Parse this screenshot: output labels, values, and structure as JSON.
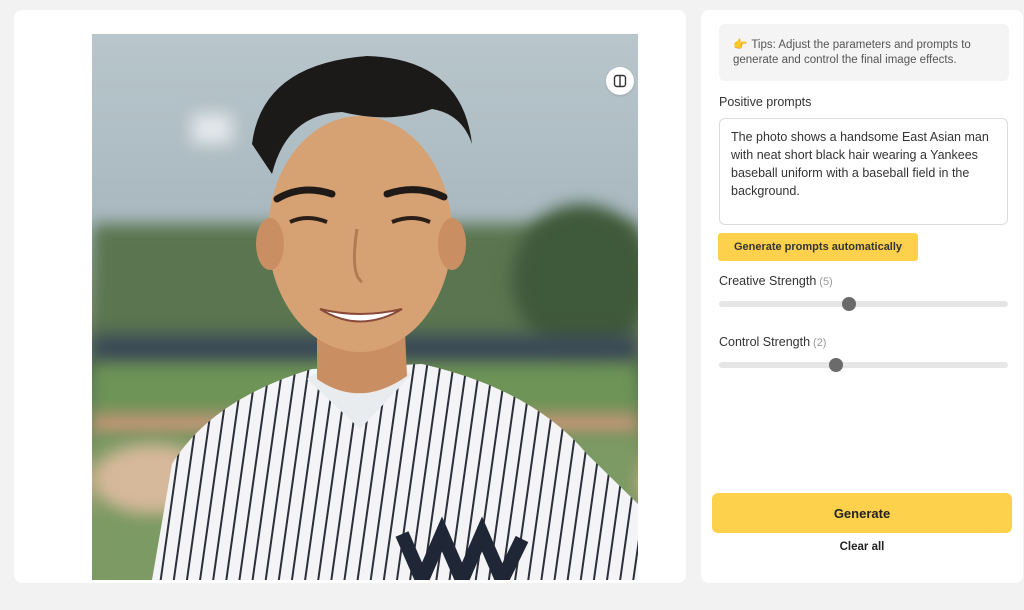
{
  "image_tools": {
    "compare_icon": "split-view-icon",
    "download_icon": "download-icon",
    "delete_icon": "trash-icon"
  },
  "tips": {
    "icon": "pointing-hand-icon",
    "text": "Tips: Adjust the parameters and prompts to generate and control the final image effects."
  },
  "positive_prompts": {
    "label": "Positive prompts",
    "value": "The photo shows a handsome East Asian man with neat short black hair wearing a Yankees baseball uniform with a baseball field in the background."
  },
  "auto_prompt_button": "Generate prompts automatically",
  "creative_strength": {
    "label": "Creative Strength",
    "value_text": "(5)",
    "value": 5,
    "fraction": 0.45
  },
  "control_strength": {
    "label": "Control Strength",
    "value_text": "(2)",
    "value": 2,
    "fraction": 0.405
  },
  "generate_button": "Generate",
  "clear_button": "Clear all",
  "colors": {
    "accent": "#fdd14c",
    "slider_thumb": "#6b6b6b"
  }
}
